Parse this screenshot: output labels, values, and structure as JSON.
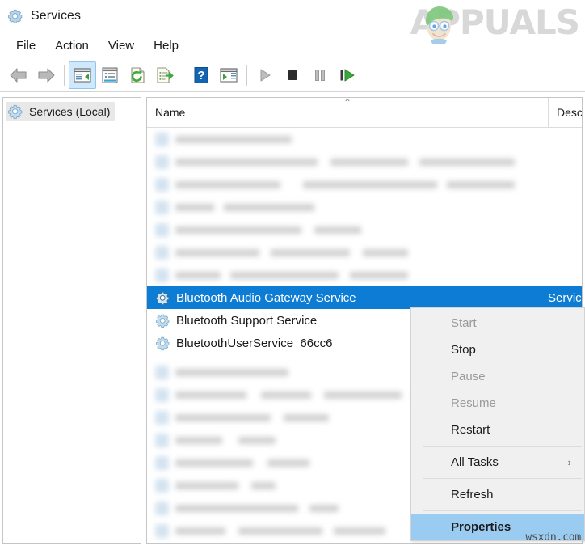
{
  "window": {
    "title": "Services",
    "icon": "gear-icon"
  },
  "watermark": {
    "brand": "APPUALS",
    "brand_prefix": "A",
    "brand_suffix": "PUALS",
    "site": "wsxdn.com",
    "color": "#d8d8d8"
  },
  "menubar": {
    "items": [
      {
        "label": "File"
      },
      {
        "label": "Action"
      },
      {
        "label": "View"
      },
      {
        "label": "Help"
      }
    ]
  },
  "toolbar": {
    "buttons": [
      {
        "name": "back-arrow-icon",
        "tip": "Back",
        "selected": false
      },
      {
        "name": "forward-arrow-icon",
        "tip": "Forward",
        "selected": false
      },
      {
        "name": "show-hide-console-tree-icon",
        "tip": "Show/Hide Console Tree",
        "selected": true
      },
      {
        "name": "properties-window-icon",
        "tip": "Properties",
        "selected": false
      },
      {
        "name": "refresh-icon",
        "tip": "Refresh",
        "selected": false
      },
      {
        "name": "export-list-icon",
        "tip": "Export List",
        "selected": false
      },
      {
        "name": "help-icon",
        "tip": "Help",
        "selected": false
      },
      {
        "name": "show-action-pane-icon",
        "tip": "Show Action Pane",
        "selected": false
      },
      {
        "name": "start-service-icon",
        "tip": "Start Service",
        "selected": false
      },
      {
        "name": "stop-service-icon",
        "tip": "Stop Service",
        "selected": false
      },
      {
        "name": "pause-service-icon",
        "tip": "Pause Service",
        "selected": false
      },
      {
        "name": "restart-service-icon",
        "tip": "Restart Service",
        "selected": false
      }
    ]
  },
  "sidebar": {
    "items": [
      {
        "label": "Services (Local)",
        "icon": "gear-icon",
        "selected": true
      }
    ]
  },
  "list": {
    "columns": [
      {
        "key": "name",
        "label": "Name",
        "sorted": true,
        "sort_indicator": "⌃"
      },
      {
        "key": "description",
        "label": "Descri"
      }
    ],
    "rows": [
      {
        "name": "Bluetooth Audio Gateway Service",
        "description": "Servic",
        "icon": "gear-icon",
        "selected": true
      },
      {
        "name": "Bluetooth Support Service",
        "description": "",
        "icon": "gear-icon",
        "selected": false
      },
      {
        "name": "BluetoothUserService_66cc6",
        "description": "",
        "icon": "gear-icon",
        "selected": false
      }
    ]
  },
  "context_menu": {
    "items": [
      {
        "label": "Start",
        "type": "item",
        "enabled": false,
        "highlight": false
      },
      {
        "label": "Stop",
        "type": "item",
        "enabled": true,
        "highlight": false
      },
      {
        "label": "Pause",
        "type": "item",
        "enabled": false,
        "highlight": false
      },
      {
        "label": "Resume",
        "type": "item",
        "enabled": false,
        "highlight": false
      },
      {
        "label": "Restart",
        "type": "item",
        "enabled": true,
        "highlight": false
      },
      {
        "label": "",
        "type": "separator"
      },
      {
        "label": "All Tasks",
        "type": "submenu",
        "enabled": true,
        "highlight": false,
        "arrow": "›"
      },
      {
        "label": "",
        "type": "separator"
      },
      {
        "label": "Refresh",
        "type": "item",
        "enabled": true,
        "highlight": false
      },
      {
        "label": "",
        "type": "separator"
      },
      {
        "label": "Properties",
        "type": "item",
        "enabled": true,
        "highlight": true
      }
    ]
  },
  "colors": {
    "selection_blue": "#0c7cd5",
    "menu_highlight": "#9acbf0",
    "toolbar_selected": "#cfe8fb",
    "window_bg": "#ffffff",
    "menu_bg": "#f0f0f0"
  }
}
